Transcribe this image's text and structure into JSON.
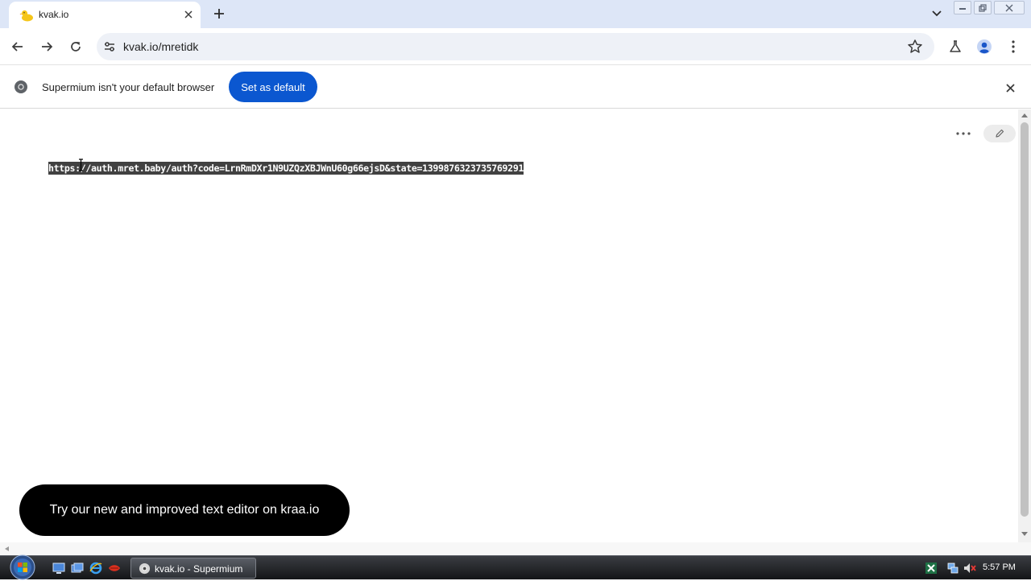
{
  "browser": {
    "tab": {
      "title": "kvak.io"
    },
    "address_bar": {
      "url": "kvak.io/mretidk"
    },
    "infobar": {
      "message": "Supermium isn't your default browser",
      "button_label": "Set as default"
    }
  },
  "document": {
    "text": "https://auth.mret.baby/auth?code=LrnRmDXr1N9UZQzXBJWnU60g66ejsD&state=139987632373576929​1"
  },
  "promo": {
    "text": "Try our new and improved text editor on kraa.io"
  },
  "taskbar": {
    "window_button_label": "kvak.io - Supermium",
    "clock": "5:57 PM"
  },
  "colors": {
    "tabstrip_bg": "#dde6f7",
    "accent_button": "#0b57d0",
    "selection_bg": "#414141"
  }
}
